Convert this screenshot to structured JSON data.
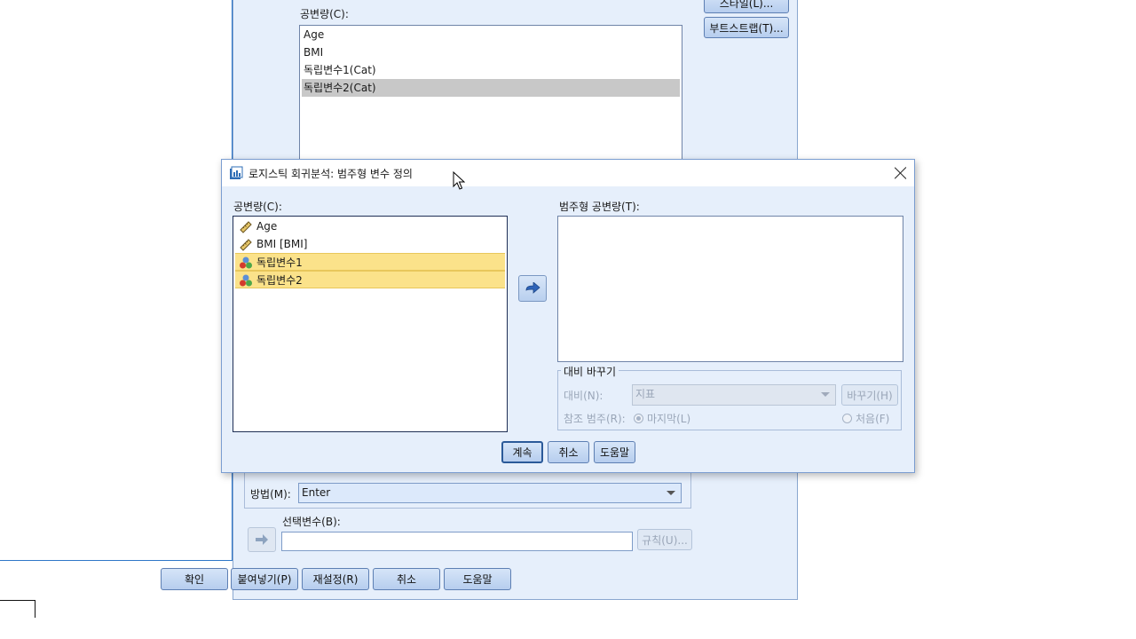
{
  "background_dialog": {
    "covariates_label": "공변량(C):",
    "covariates": [
      "Age",
      "BMI",
      "독립변수1(Cat)",
      "독립변수2(Cat)"
    ],
    "selected_covariate_index": 3,
    "style_button": "스타일(L)...",
    "bootstrap_button": "부트스트랩(T)...",
    "method_label": "방법(M):",
    "method_value": "Enter",
    "selection_variable_label": "선택변수(B):",
    "selection_variable_value": "",
    "rule_button": "규칙(U)...",
    "buttons": {
      "ok": "확인",
      "paste": "붙여넣기(P)",
      "reset": "재설정(R)",
      "cancel": "취소",
      "help": "도움말"
    }
  },
  "dialog": {
    "title": "로지스틱 회귀분석: 범주형 변수 정의",
    "covariates_label": "공변량(C):",
    "covariates": [
      {
        "label": "Age",
        "icon": "scale-ruler-icon",
        "highlighted": false
      },
      {
        "label": "BMI  [BMI]",
        "icon": "scale-ruler-icon",
        "highlighted": false
      },
      {
        "label": "독립변수1",
        "icon": "nominal-balls-icon",
        "highlighted": true
      },
      {
        "label": "독립변수2",
        "icon": "nominal-balls-icon",
        "highlighted": true
      }
    ],
    "categorical_covariates_label": "범주형 공변량(T):",
    "change_contrast": {
      "group_label": "대비 바꾸기",
      "contrast_label": "대비(N):",
      "contrast_value": "지표",
      "change_button": "바꾸기(H)",
      "reference_label": "참조 범주(R):",
      "last_option": "마지막(L)",
      "first_option": "처음(F)",
      "reference_selected": "last"
    },
    "buttons": {
      "continue": "계속",
      "cancel": "취소",
      "help": "도움말"
    }
  },
  "colors": {
    "dialog_bg": "#e6effb",
    "highlight": "#fbe28a",
    "selection_gray": "#c8c8c8",
    "accent_border": "#2b5a99"
  }
}
